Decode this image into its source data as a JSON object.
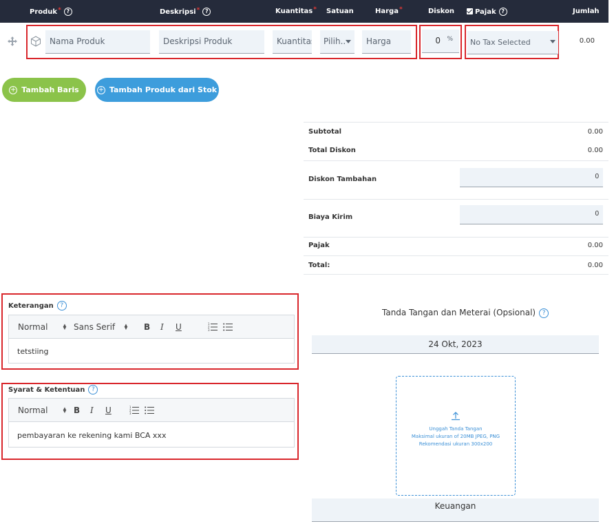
{
  "header": {
    "produk": "Produk",
    "deskripsi": "Deskripsi",
    "kuantitas": "Kuantitas",
    "satuan": "Satuan",
    "harga": "Harga",
    "diskon": "Diskon",
    "pajak": "Pajak",
    "jumlah": "Jumlah",
    "required_mark": "*",
    "help_glyph": "?"
  },
  "row": {
    "product_placeholder": "Nama Produk",
    "description_placeholder": "Deskripsi Produk",
    "quantity_placeholder": "Kuantitas",
    "unit_value": "Pilih..",
    "price_placeholder": "Harga",
    "discount_value": "0",
    "discount_unit": "%",
    "tax_value": "No Tax Selected",
    "amount": "0.00"
  },
  "buttons": {
    "add_row": "Tambah Baris",
    "add_from_stock": "Tambah Produk dari Stok"
  },
  "totals": {
    "subtotal_label": "Subtotal",
    "subtotal_value": "0.00",
    "total_discount_label": "Total Diskon",
    "total_discount_value": "0.00",
    "extra_discount_label": "Diskon Tambahan",
    "extra_discount_value": "0",
    "shipping_label": "Biaya Kirim",
    "shipping_value": "0",
    "tax_label": "Pajak",
    "tax_value": "0.00",
    "total_label": "Total:",
    "total_value": "0.00"
  },
  "notes": {
    "label": "Keterangan",
    "format": "Normal",
    "font": "Sans Serif",
    "bold": "B",
    "italic": "I",
    "underline": "U",
    "content": "tetstiing"
  },
  "terms": {
    "label": "Syarat & Ketentuan",
    "format": "Normal",
    "bold": "B",
    "italic": "I",
    "underline": "U",
    "content": "pembayaran ke rekening kami BCA xxx"
  },
  "signature": {
    "title": "Tanda Tangan dan Meterai (Opsional)",
    "date": "24 Okt, 2023",
    "upload_line1": "Unggah Tanda Tangan",
    "upload_line2": "Maksimal ukuran of 20MB JPEG, PNG",
    "upload_line3": "Rekomendasi ukuran 300x200",
    "role": "Keuangan"
  },
  "colors": {
    "header_bg": "#252b3b",
    "add_row_btn": "#8bc34a",
    "add_stock_btn": "#3d9ddc",
    "highlight_border": "#d9262b",
    "accent_blue": "#3a8fd6"
  }
}
